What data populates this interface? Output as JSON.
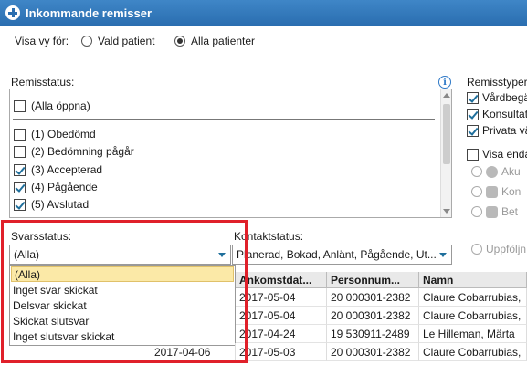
{
  "window": {
    "title": "Inkommande remisser"
  },
  "view_for": {
    "label": "Visa vy för:",
    "options": [
      {
        "label": "Vald patient",
        "checked": false
      },
      {
        "label": "Alla patienter",
        "checked": true
      }
    ]
  },
  "remisstatus": {
    "label": "Remisstatus:",
    "items": [
      {
        "label": "(Alla öppna)",
        "checked": false
      },
      {
        "label": "(1) Obedömd",
        "checked": false
      },
      {
        "label": "(2) Bedömning pågår",
        "checked": false
      },
      {
        "label": "(3) Accepterad",
        "checked": true
      },
      {
        "label": "(4) Pågående",
        "checked": true
      },
      {
        "label": "(5) Avslutad",
        "checked": true
      }
    ]
  },
  "right_panel": {
    "label": "Remisstyper",
    "types": [
      {
        "label": "Vårdbegä",
        "checked": true
      },
      {
        "label": "Konsultat",
        "checked": true
      },
      {
        "label": "Privata vä",
        "checked": true
      }
    ],
    "visa_enda": {
      "label": "Visa enda",
      "checked": false
    },
    "sub_options": [
      {
        "label": "Aku",
        "icon": "clock-icon"
      },
      {
        "label": "Kon",
        "icon": "document-icon"
      },
      {
        "label": "Bet",
        "icon": "document-icon"
      }
    ],
    "uppfoljn": "Uppföljn"
  },
  "svarsstatus": {
    "label": "Svarsstatus:",
    "value": "(Alla)",
    "options": [
      "(Alla)",
      "Inget svar skickat",
      "Delsvar skickat",
      "Skickat slutsvar",
      "Inget slutsvar skickat"
    ]
  },
  "kontaktstatus": {
    "label": "Kontaktstatus:",
    "value": "Planerad, Bokad, Anlänt, Pågående, Ut..."
  },
  "table": {
    "columns": [
      "Ankomstdat...",
      "Personnum...",
      "Namn"
    ],
    "rows": [
      {
        "date": "2017-05-04",
        "pnr": "20 000301-2382",
        "name": "Claure Cobarrubias,"
      },
      {
        "date": "2017-05-04",
        "pnr": "20 000301-2382",
        "name": "Claure Cobarrubias,"
      },
      {
        "date": "2017-04-24",
        "pnr": "19 530911-2489",
        "name": "Le Hilleman, Märta"
      },
      {
        "date": "2017-05-03",
        "pnr": "20 000301-2382",
        "name": "Claure Cobarrubias,"
      }
    ],
    "extra_date": "2017-04-06"
  },
  "colors": {
    "title_bar": "#2a6eb0",
    "highlight": "#e0202a",
    "selected_option": "#fbe9a7"
  }
}
